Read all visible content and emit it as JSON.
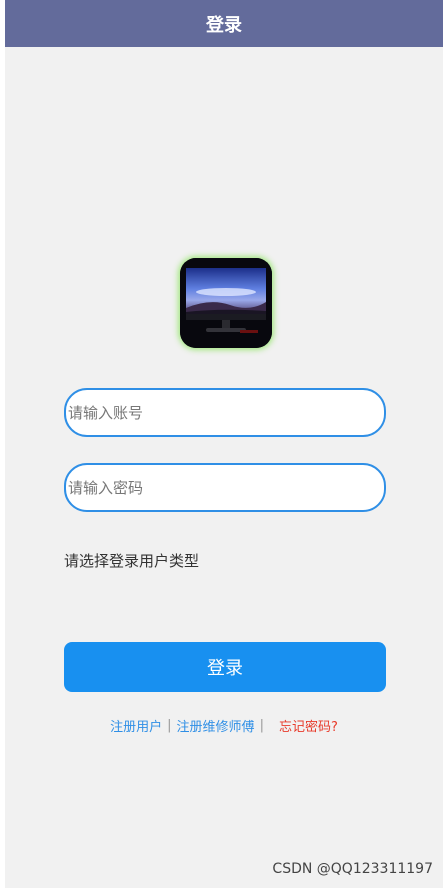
{
  "header": {
    "title": "登录"
  },
  "logo": {
    "icon": "monitor-landscape-icon"
  },
  "form": {
    "account_placeholder": "请输入账号",
    "password_placeholder": "请输入密码",
    "user_type_label": "请选择登录用户类型",
    "login_label": "登录"
  },
  "links": {
    "register_user": "注册用户",
    "register_technician": "注册维修师傅",
    "separator": "|",
    "forgot_password": "忘记密码?"
  },
  "watermark": "CSDN @QQ123311197",
  "colors": {
    "nav_background": "#636b9b",
    "accent": "#1890f0",
    "link": "#2f8fe6",
    "forgot_link": "#e83a2a",
    "page_background": "#f1f1f1"
  }
}
